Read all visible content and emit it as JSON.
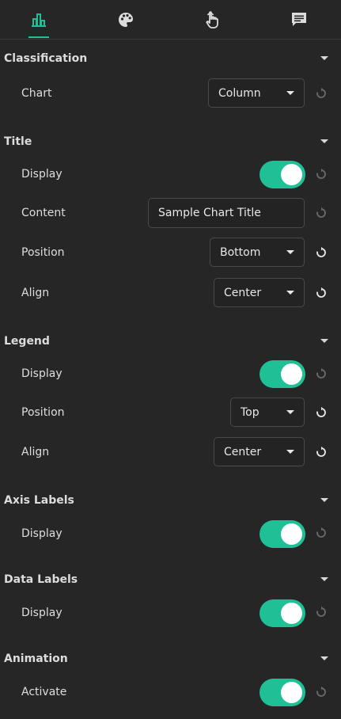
{
  "tabs": [
    {
      "icon": "bar-chart-icon",
      "active": true
    },
    {
      "icon": "palette-icon",
      "active": false
    },
    {
      "icon": "touch-hand-icon",
      "active": false
    },
    {
      "icon": "comment-icon",
      "active": false
    }
  ],
  "colors": {
    "accent": "#1fc096",
    "background": "#262626",
    "reset_active": "#e8e8e8",
    "reset_disabled": "#6a6a6a"
  },
  "sections": {
    "classification": {
      "title": "Classification",
      "chart_label": "Chart",
      "chart_value": "Column"
    },
    "title": {
      "title": "Title",
      "display_label": "Display",
      "display_on": true,
      "content_label": "Content",
      "content_value": "Sample Chart Title",
      "position_label": "Position",
      "position_value": "Bottom",
      "align_label": "Align",
      "align_value": "Center"
    },
    "legend": {
      "title": "Legend",
      "display_label": "Display",
      "display_on": true,
      "position_label": "Position",
      "position_value": "Top",
      "align_label": "Align",
      "align_value": "Center"
    },
    "axis_labels": {
      "title": "Axis Labels",
      "display_label": "Display",
      "display_on": true
    },
    "data_labels": {
      "title": "Data Labels",
      "display_label": "Display",
      "display_on": true
    },
    "animation": {
      "title": "Animation",
      "activate_label": "Activate",
      "activate_on": true
    }
  }
}
